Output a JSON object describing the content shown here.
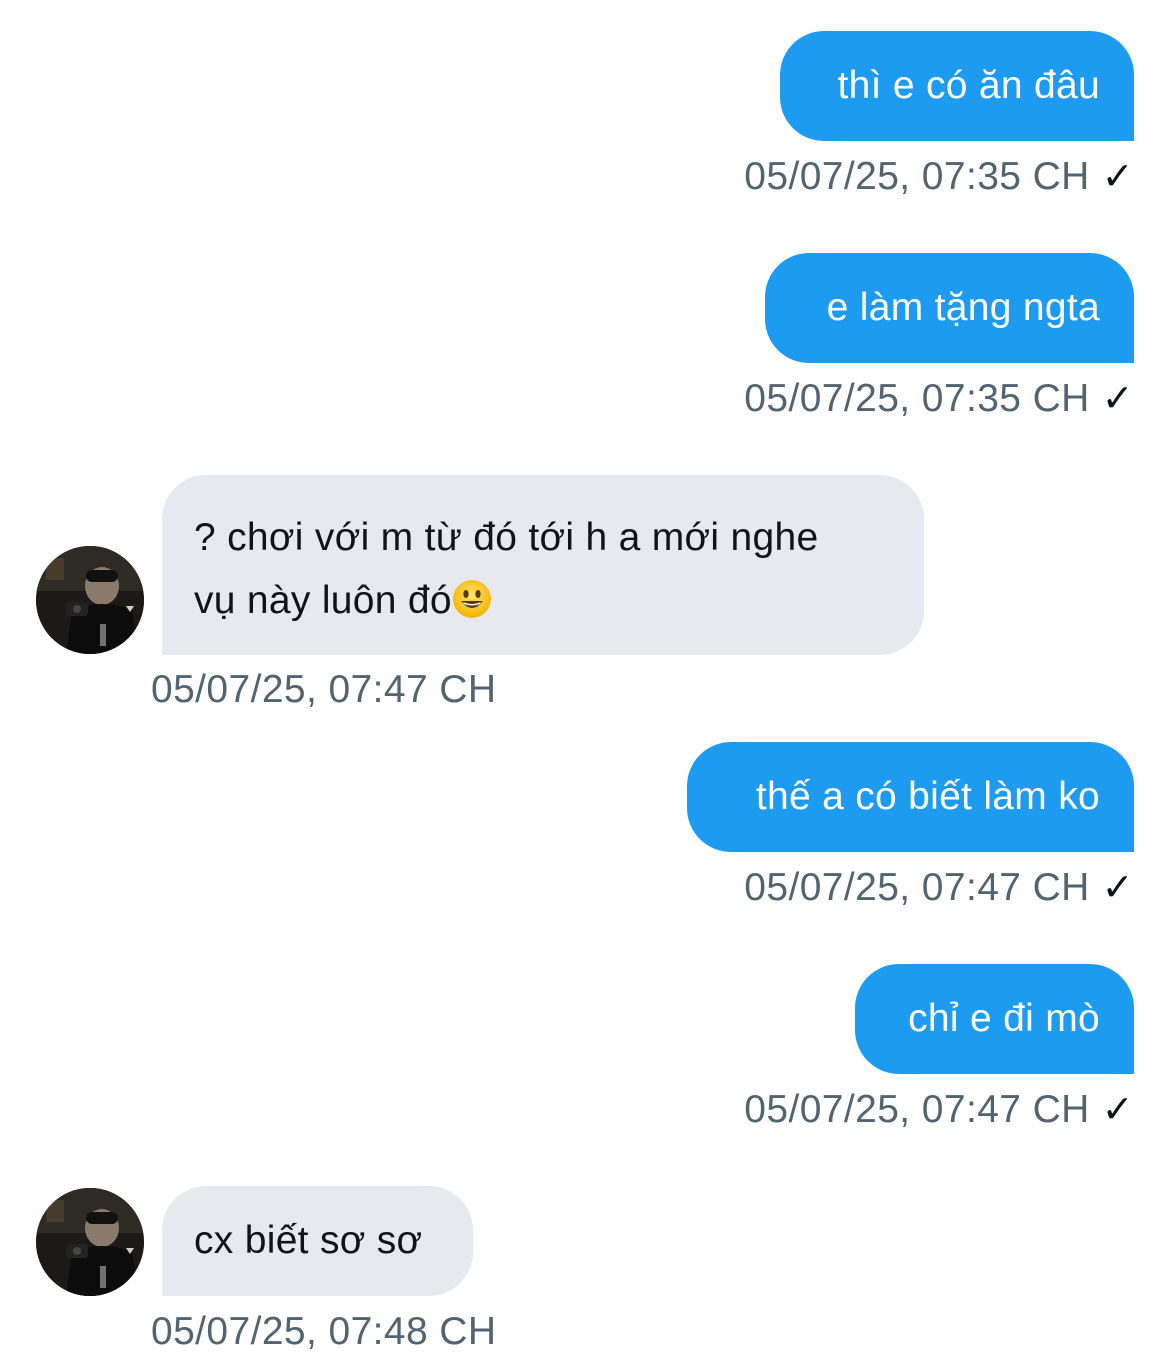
{
  "messages": [
    {
      "direction": "sent",
      "text": "thì e có ăn đâu",
      "timestamp": "05/07/25, 07:35 CH",
      "status": "✓"
    },
    {
      "direction": "sent",
      "text": "e làm tặng ngta",
      "timestamp": "05/07/25, 07:35 CH",
      "status": "✓"
    },
    {
      "direction": "received",
      "line1": "? chơi với m từ đó tới h a mới nghe",
      "line2": "vụ này luôn đó",
      "emoji": "😃",
      "timestamp": "05/07/25, 07:47 CH"
    },
    {
      "direction": "sent",
      "text": "thế a có biết làm ko",
      "timestamp": "05/07/25, 07:47 CH",
      "status": "✓"
    },
    {
      "direction": "sent",
      "text": "chỉ e đi mò",
      "timestamp": "05/07/25, 07:47 CH",
      "status": "✓"
    },
    {
      "direction": "received",
      "text": "cx biết sơ sơ",
      "timestamp": "05/07/25, 07:48 CH"
    }
  ],
  "colors": {
    "sent_bubble": "#1d9bf0",
    "received_bubble": "#e7e9ee",
    "timestamp": "#536471"
  }
}
